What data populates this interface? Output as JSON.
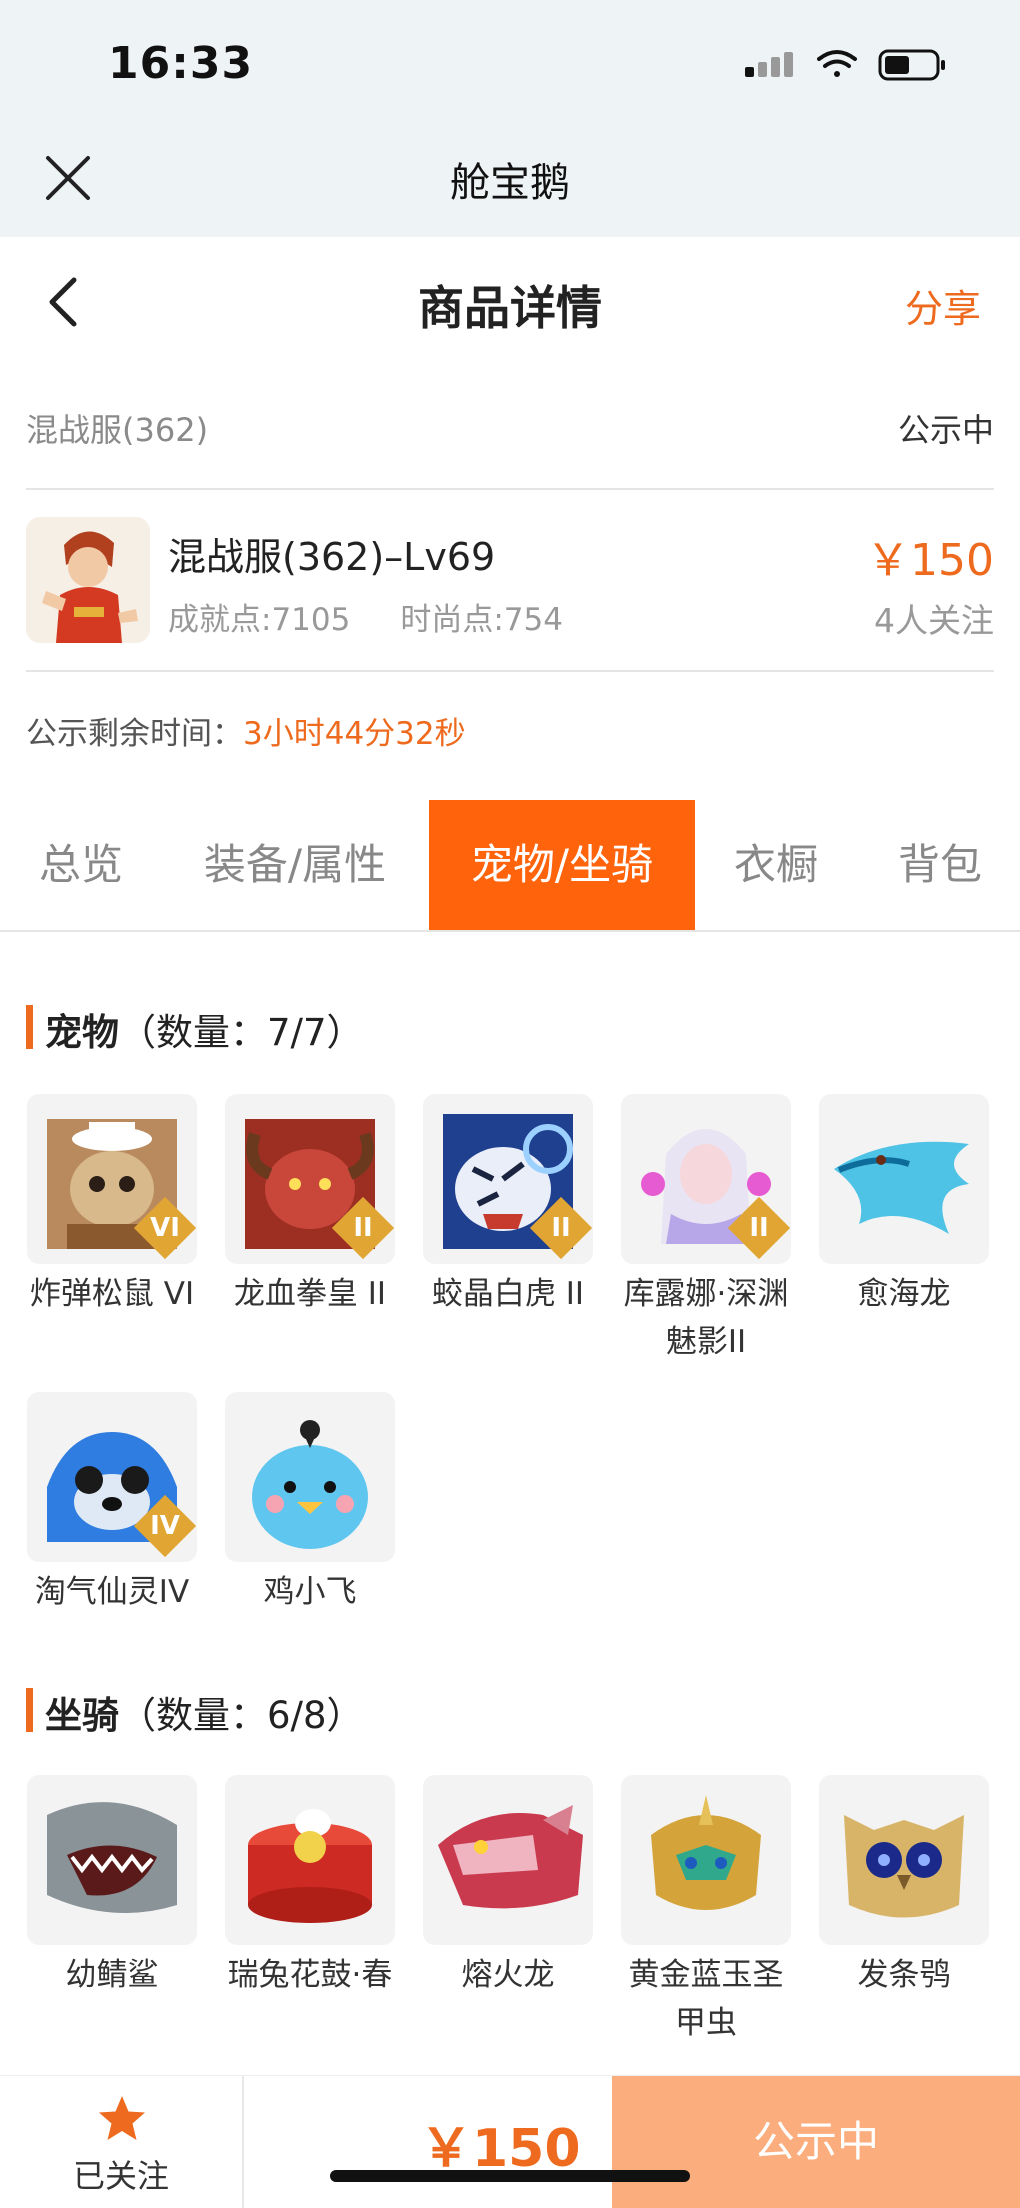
{
  "status_bar": {
    "time": "16:33"
  },
  "app": {
    "title": "舱宝鹅"
  },
  "nav": {
    "title": "商品详情",
    "share_label": "分享"
  },
  "listing": {
    "server": "混战服(362)",
    "status": "公示中",
    "name": "混战服(362)–Lv69",
    "achievement": "成就点:7105",
    "fashion": "时尚点:754",
    "price": "￥150",
    "followers": "4人关注",
    "remain_label": "公示剩余时间：",
    "remain_value": "3小时44分32秒"
  },
  "tabs": [
    {
      "label": "总览",
      "active": false
    },
    {
      "label": "装备/属性",
      "active": false
    },
    {
      "label": "宠物/坐骑",
      "active": true
    },
    {
      "label": "衣橱",
      "active": false
    },
    {
      "label": "背包",
      "active": false
    }
  ],
  "pets": {
    "title": "宠物",
    "count": "（数量：7/7）",
    "items": [
      {
        "name": "炸弹松鼠 VI",
        "badge": "VI"
      },
      {
        "name": "龙血拳皇 II",
        "badge": "II"
      },
      {
        "name": "蛟晶白虎 II",
        "badge": "II"
      },
      {
        "name": "库露娜·深渊魅影II",
        "badge": "II"
      },
      {
        "name": "愈海龙",
        "badge": ""
      },
      {
        "name": "淘气仙灵IV",
        "badge": "IV"
      },
      {
        "name": "鸡小飞",
        "badge": ""
      }
    ]
  },
  "mounts": {
    "title": "坐骑",
    "count": "（数量：6/8）",
    "items": [
      {
        "name": "幼鲭鲨"
      },
      {
        "name": "瑞兔花鼓·春"
      },
      {
        "name": "熔火龙"
      },
      {
        "name": "黄金蓝玉圣甲虫"
      },
      {
        "name": "发条鸮"
      }
    ]
  },
  "bottom_bar": {
    "follow_label": "已关注",
    "price": "￥150",
    "status": "公示中"
  },
  "colors": {
    "accent": "#ee6a1e",
    "tab_active": "#ff630c",
    "button_disabled": "#fbad7e"
  }
}
